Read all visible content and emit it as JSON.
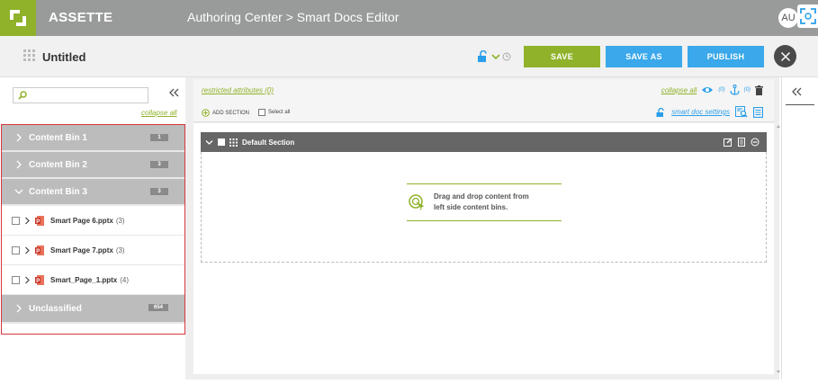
{
  "header": {
    "brand": "ASSETTE",
    "breadcrumb": "Authoring Center > Smart Docs Editor",
    "avatar_initials": "AU"
  },
  "document": {
    "title": "Untitled"
  },
  "actions": {
    "save": "SAVE",
    "save_as": "SAVE AS",
    "publish": "PUBLISH"
  },
  "left_panel": {
    "search_placeholder": "",
    "collapse_all": "collapse all",
    "bins": [
      {
        "label": "Content Bin 1",
        "count": "1"
      },
      {
        "label": "Content Bin 2",
        "count": "3"
      },
      {
        "label": "Content Bin 3",
        "count": "3"
      }
    ],
    "files": [
      {
        "name": "Smart Page 6.pptx",
        "count": "(3)"
      },
      {
        "name": "Smart Page 7.pptx",
        "count": "(3)"
      },
      {
        "name": "Smart_Page_1.pptx",
        "count": "(4)"
      }
    ],
    "unclassified": {
      "label": "Unclassified",
      "count": "654"
    }
  },
  "toolbar": {
    "restricted": "restricted attributes (0)",
    "add_section": "ADD SECTION",
    "select_all": "Select all",
    "collapse_all": "collapse all",
    "view_count": "(0)",
    "anchor_count": "(0)",
    "smart_doc_settings": "smart doc settings"
  },
  "section": {
    "title": "Default Section",
    "drop_line1": "Drag and drop content from",
    "drop_line2": "left side content bins."
  },
  "colors": {
    "green": "#8fb22a",
    "blue": "#3aa8ea",
    "header_gray": "#999b9a",
    "highlight_red": "#d9363e"
  }
}
